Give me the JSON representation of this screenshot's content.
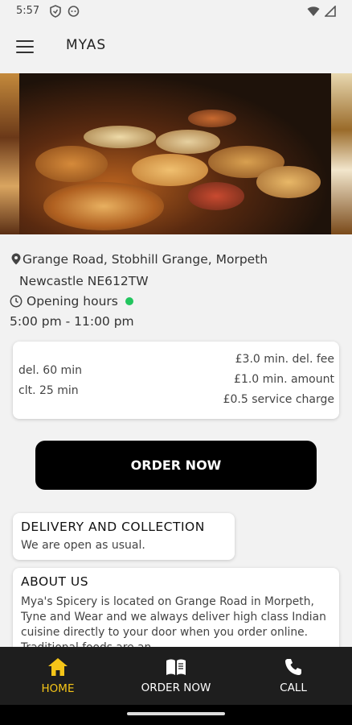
{
  "status_bar": {
    "time": "5:57"
  },
  "app_bar": {
    "title": "MYAS"
  },
  "restaurant": {
    "address_line1": "Grange Road, Stobhill Grange, Morpeth",
    "address_line2": "Newcastle  NE612TW",
    "opening_hours_label": "Opening hours",
    "open_status_color": "#22c55e",
    "opening_hours_time": "5:00 pm - 11:00 pm"
  },
  "info": {
    "delivery_time": "del. 60 min",
    "collection_time": "clt. 25 min",
    "min_delivery_fee": "£3.0 min. del. fee",
    "min_amount": "£1.0 min. amount",
    "service_charge": "£0.5 service charge"
  },
  "order_button": {
    "label": "ORDER NOW"
  },
  "notice": {
    "title": "DELIVERY AND COLLECTION",
    "body": "We are open as usual."
  },
  "about": {
    "title": "ABOUT US",
    "body": "Mya's Spicery is located on Grange Road in Morpeth, Tyne and Wear and we always deliver high class Indian cuisine directly to your door when you order online. Traditional foods are an"
  },
  "bottom_nav": {
    "items": [
      {
        "label": "HOME",
        "icon": "home-icon",
        "active": true
      },
      {
        "label": "ORDER NOW",
        "icon": "menu-book-icon",
        "active": false
      },
      {
        "label": "CALL",
        "icon": "phone-icon",
        "active": false
      }
    ],
    "active_color": "#f5c518"
  }
}
